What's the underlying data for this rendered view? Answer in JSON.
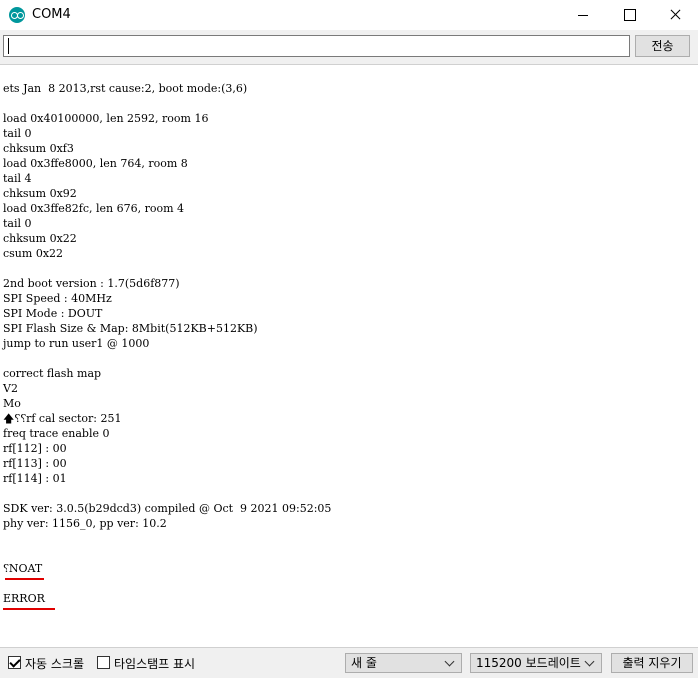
{
  "window": {
    "title": "COM4"
  },
  "input": {
    "value": "",
    "send_label": "전송"
  },
  "output_lines": [
    "ets Jan  8 2013,rst cause:2, boot mode:(3,6)",
    "",
    "load 0x40100000, len 2592, room 16",
    "tail 0",
    "chksum 0xf3",
    "load 0x3ffe8000, len 764, room 8",
    "tail 4",
    "chksum 0x92",
    "load 0x3ffe82fc, len 676, room 4",
    "tail 0",
    "chksum 0x22",
    "csum 0x22",
    "",
    "2nd boot version : 1.7(5d6f877)",
    "SPI Speed : 40MHz",
    "SPI Mode : DOUT",
    "SPI Flash Size & Map: 8Mbit(512KB+512KB)",
    "jump to run user1 @ 1000",
    "",
    "correct flash map",
    "V2",
    "Mo",
    "🡅⸮⸮rf cal sector: 251",
    "freq trace enable 0",
    "rf[112] : 00",
    "rf[113] : 00",
    "rf[114] : 01",
    "",
    "SDK ver: 3.0.5(b29dcd3) compiled @ Oct  9 2021 09:52:05",
    "phy ver: 1156_0, pp ver: 10.2",
    "",
    "",
    "⸮NOAT",
    "",
    "ERROR"
  ],
  "footer": {
    "autoscroll_label": "자동 스크롤",
    "autoscroll_checked": true,
    "timestamp_label": "타임스탬프 표시",
    "timestamp_checked": false,
    "line_ending": "새 줄",
    "baud": "115200 보드레이트",
    "clear_label": "출력 지우기"
  },
  "colors": {
    "annotation_underline": "#e00000",
    "arduino_teal": "#00979c"
  },
  "icons": {
    "app": "arduino-icon",
    "minimize": "minimize-icon",
    "maximize": "maximize-icon",
    "close": "close-icon"
  }
}
